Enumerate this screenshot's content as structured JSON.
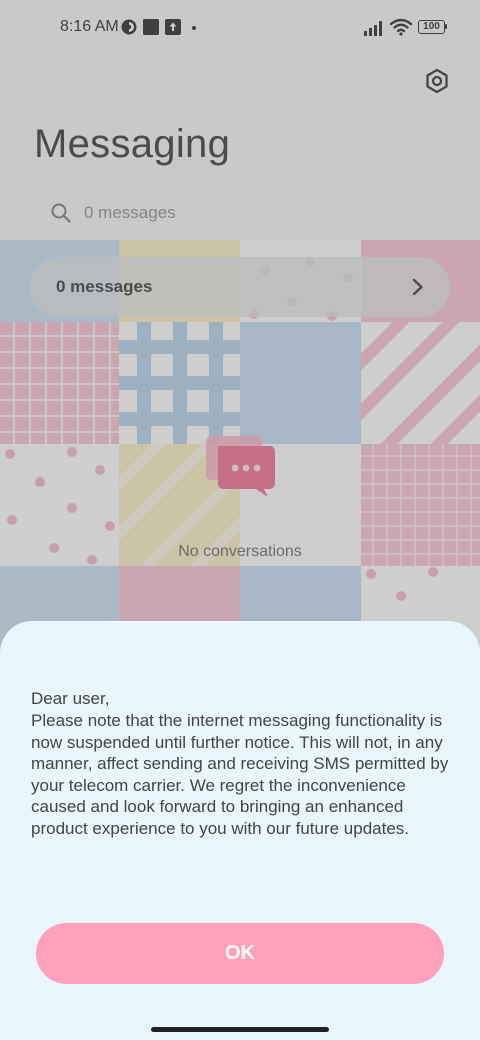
{
  "status_bar": {
    "time": "8:16 AM",
    "battery": "100",
    "icons": [
      "mode-icon",
      "square-notification-icon",
      "upload-notification-icon",
      "more-dot-icon",
      "signal-icon",
      "wifi-icon",
      "battery-icon"
    ]
  },
  "header": {
    "title": "Messaging",
    "settings_icon": "gear-icon"
  },
  "search": {
    "placeholder": "0 messages",
    "icon": "search-icon"
  },
  "message_count_card": {
    "label": "0 messages",
    "icon": "chevron-right-icon"
  },
  "empty_state": {
    "icon": "chat-bubble-icon",
    "text": "No conversations"
  },
  "dialog": {
    "greeting": "Dear user,",
    "body": "Please note that the internet messaging functionality is now suspended until further notice. This will not, in any manner, affect sending and receiving SMS permitted by your telecom carrier. We regret the inconvenience caused and look forward to bringing an enhanced product experience to you with our future updates.",
    "ok_label": "OK"
  },
  "colors": {
    "accent": "#ffa1ba",
    "sheet_background": "#e9f6fd",
    "chat_icon": "#f36c91"
  }
}
